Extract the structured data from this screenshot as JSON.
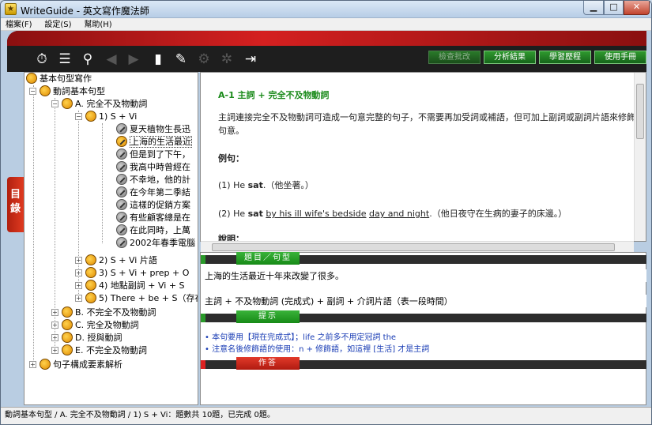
{
  "window": {
    "title": "WriteGuide - 英文寫作魔法師",
    "app_icon_glyph": "★"
  },
  "menubar": {
    "items": [
      "檔案(F)",
      "設定(S)",
      "幫助(H)"
    ]
  },
  "toolbar": {
    "icons": [
      "timer-icon",
      "sort-icon",
      "search-icon",
      "back-icon",
      "forward-icon",
      "book-icon",
      "pencil-icon",
      "gear-icon",
      "settings-icon",
      "exit-icon"
    ],
    "buttons": {
      "check": "檢查批改",
      "analysis": "分析結果",
      "history": "學習歷程",
      "manual": "使用手冊"
    }
  },
  "side_tab": {
    "label_1": "目",
    "label_2": "錄"
  },
  "tree": {
    "root": "基本句型寫作",
    "level1": "動詞基本句型",
    "A": "A. 完全不及物動詞",
    "s1": "1) S + Vi",
    "items": [
      "夏天植物生長迅",
      "上海的生活最近",
      "但是到了下午，",
      "我高中時曾經在",
      "不幸地，他的計",
      "在今年第二季結",
      "這樣的促銷方案",
      "有些顧客總是在",
      "在此同時，上萬",
      "2002年春季電腦"
    ],
    "s2": "2) S + Vi 片語",
    "s3": "3) S + Vi + prep + O",
    "s4": "4) 地點副詞 + Vi + S",
    "s5": "5) There + be + S（存在",
    "B": "B. 不完全不及物動詞",
    "C": "C. 完全及物動詞",
    "D": "D. 授與動詞",
    "E": "E. 不完全及物動詞",
    "analysis": "句子構成要素解析"
  },
  "content": {
    "heading": "A-1  主詞 + 完全不及物動詞",
    "para": "主詞連接完全不及物動詞可造成一句意完整的句子，不需要再加受詞或補語，但可加上副詞或副詞片語來修飾句意。",
    "example_label": "例句：",
    "ex1_pre": "(1) He ",
    "ex1_verb": "sat",
    "ex1_post": ".（他坐著。）",
    "ex2_pre": "(2) He ",
    "ex2_verb": "sat",
    "ex2_u1": "by his ill wife's bedside",
    "ex2_u2": "day and night",
    "ex2_post": ".（他日夜守在生病的妻子的床邊。）",
    "explain_label": "說明："
  },
  "sections": {
    "topic_tab": "題目／句型",
    "topic_sentence": "上海的生活最近十年來改變了很多。",
    "pattern": "主詞 + 不及物動詞 (完成式) + 副詞 + 介詞片語（表一段時間）",
    "hint_tab": "提示",
    "hints": [
      "本句要用【現在完成式】；life 之前多不用定冠詞 the",
      "注意名後修飾語的使用：n + 修飾語，如這裡 [生活] 才是主詞"
    ],
    "answer_tab": "作答"
  },
  "status": "動詞基本句型 / A. 完全不及物動詞 / 1) S + Vi：題數共 10題，已完成 0題。"
}
